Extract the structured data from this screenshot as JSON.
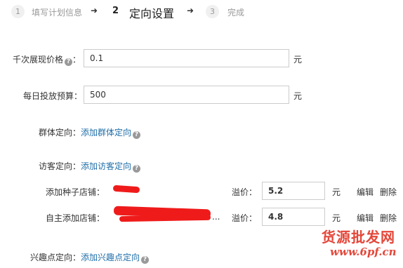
{
  "steps": [
    {
      "num": "1",
      "label": "填写计划信息"
    },
    {
      "num": "2",
      "label": "定向设置"
    },
    {
      "num": "3",
      "label": "完成"
    }
  ],
  "arrow": "➜",
  "fields": {
    "cpm_label": "千次展现价格",
    "cpm_value": "0.1",
    "cpm_unit": "元",
    "budget_label": "每日投放预算：",
    "budget_value": "500",
    "budget_unit": "元",
    "colon": "："
  },
  "targeting": {
    "group_label": "群体定向：",
    "group_link": "添加群体定向",
    "visitor_label": "访客定向：",
    "visitor_link": "添加访客定向",
    "interest_label": "兴趣点定向：",
    "interest_link": "添加兴趣点定向"
  },
  "shops": [
    {
      "label": "添加种子店铺：",
      "premium_label": "溢价：",
      "premium_value": "5.2",
      "unit": "元",
      "edit": "编辑",
      "delete": "删除"
    },
    {
      "label": "自主添加店铺：",
      "trailing": "...",
      "premium_label": "溢价：",
      "premium_value": "4.8",
      "unit": "元",
      "edit": "编辑",
      "delete": "删除"
    }
  ],
  "help_glyph": "?",
  "watermark": {
    "title": "货源批发网",
    "url": "www.6pf.cn"
  },
  "colors": {
    "link": "#1f6ea8",
    "redaction": "#ef1b1b",
    "watermark": "#e4473a"
  }
}
